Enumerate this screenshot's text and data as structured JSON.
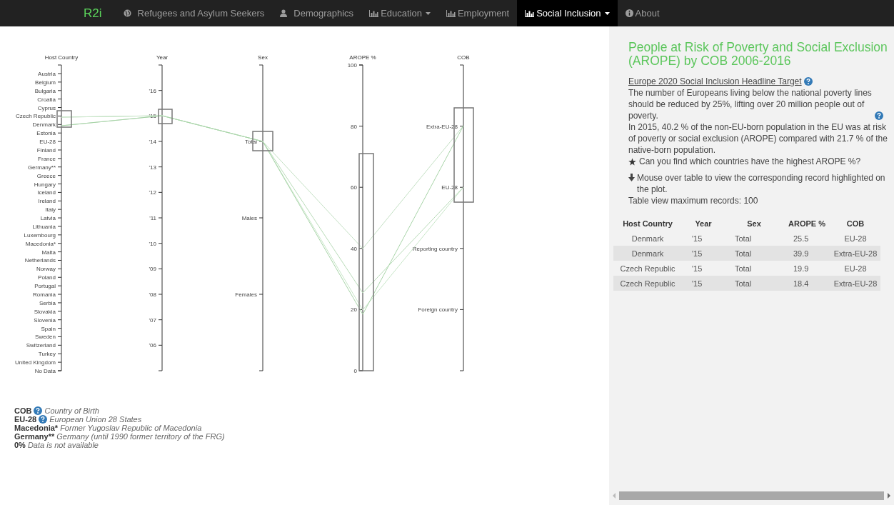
{
  "nav": {
    "brand": "R2i",
    "items": [
      {
        "label": "Refugees and Asylum Seekers",
        "dropdown": false,
        "selected": false
      },
      {
        "label": "Demographics",
        "dropdown": false,
        "selected": false
      },
      {
        "label": "Education",
        "dropdown": true,
        "selected": false
      },
      {
        "label": "Employment",
        "dropdown": false,
        "selected": false
      },
      {
        "label": "Social Inclusion",
        "dropdown": true,
        "selected": true
      },
      {
        "label": "About",
        "dropdown": false,
        "selected": false
      }
    ]
  },
  "plot": {
    "axes": [
      {
        "title": "Host Country",
        "kind": "list",
        "ticks": [
          "Austria",
          "Belgium",
          "Bulgaria",
          "Croatia",
          "Cyprus",
          "Czech Republic",
          "Denmark",
          "Estonia",
          "EU-28",
          "Finland",
          "France",
          "Germany**",
          "Greece",
          "Hungary",
          "Iceland",
          "Ireland",
          "Italy",
          "Latvia",
          "Lithuania",
          "Luxembourg",
          "Macedonia*",
          "Malta",
          "Netherlands",
          "Norway",
          "Poland",
          "Portugal",
          "Romania",
          "Serbia",
          "Slovakia",
          "Slovenia",
          "Spain",
          "Sweden",
          "Switzerland",
          "Turkey",
          "United Kingdom",
          "No Data"
        ]
      },
      {
        "title": "Year",
        "kind": "ordinal",
        "ticks": [
          "'16",
          "'15",
          "'14",
          "'13",
          "'12",
          "'11",
          "'10",
          "'09",
          "'08",
          "'07",
          "'06"
        ]
      },
      {
        "title": "Sex",
        "kind": "ordinal",
        "ticks": [
          "Total",
          "Males",
          "Females"
        ]
      },
      {
        "title": "AROPE %",
        "kind": "linear",
        "ticks": [
          "100",
          "80",
          "60",
          "40",
          "20",
          "0"
        ]
      },
      {
        "title": "COB",
        "kind": "ordinal",
        "ticks": [
          "Extra-EU-28",
          "EU-28",
          "Reporting country",
          "Foreign country"
        ]
      }
    ]
  },
  "legend": [
    {
      "term": "COB",
      "help": true,
      "description": "Country of Birth"
    },
    {
      "term": "EU-28",
      "help": true,
      "description": "European Union 28 States"
    },
    {
      "term": "Macedonia*",
      "help": false,
      "description": "Former Yugoslav Republic of Macedonia"
    },
    {
      "term": "Germany**",
      "help": false,
      "description": "Germany (until 1990 former territory of the FRG)"
    },
    {
      "term": "0%",
      "help": false,
      "description": "Data is not available"
    }
  ],
  "panel": {
    "title": "People at Risk of Poverty and Social Exclusion (AROPE) by COB 2006-2016",
    "target_link": "Europe 2020 Social Inclusion Headline Target",
    "target_text": "The number of Europeans living below the national poverty lines should be reduced by 25%, lifting over 20 million people out of poverty.",
    "stat_text": "In 2015, 40.2 % of the non-EU-born population in the EU was at risk of poverty or social exclusion (AROPE) compared with 21.7 % of the native-born population.",
    "question": "Can you find which countries have the highest AROPE %?",
    "hint": "Mouse over table to view the corresponding record highlighted on the plot.",
    "max_records": "Table view maximum records: 100",
    "table": {
      "columns": [
        "Host Country",
        "Year",
        "Sex",
        "AROPE %",
        "COB"
      ],
      "rows": [
        [
          "Denmark",
          "'15",
          "Total",
          "25.5",
          "EU-28"
        ],
        [
          "Denmark",
          "'15",
          "Total",
          "39.9",
          "Extra-EU-28"
        ],
        [
          "Czech Republic",
          "'15",
          "Total",
          "19.9",
          "EU-28"
        ],
        [
          "Czech Republic",
          "'15",
          "Total",
          "18.4",
          "Extra-EU-28"
        ]
      ]
    }
  }
}
